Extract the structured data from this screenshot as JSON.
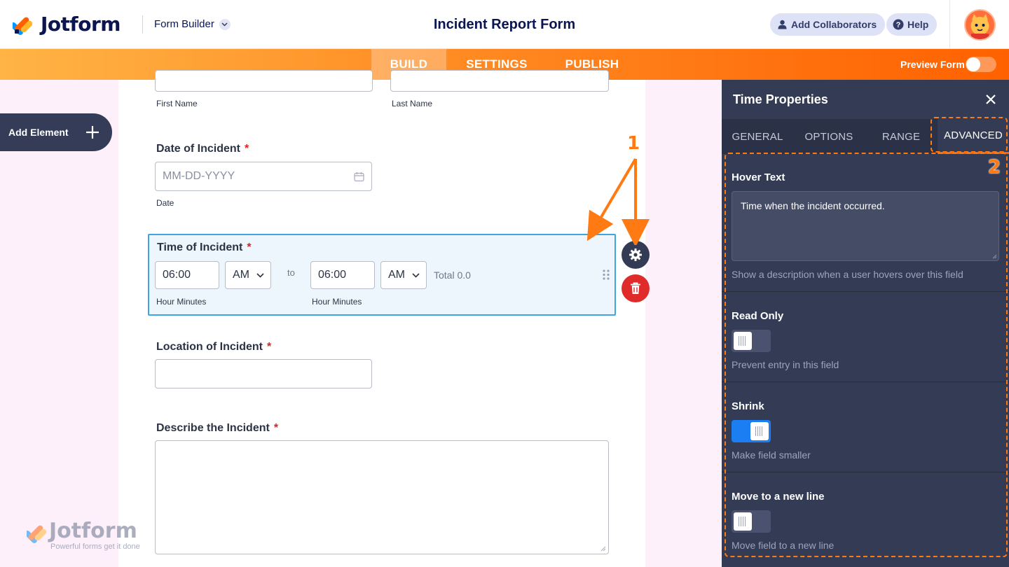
{
  "header": {
    "logo_text": "Jotform",
    "form_builder_label": "Form Builder",
    "form_title": "Incident Report Form",
    "add_collaborators_label": "Add Collaborators",
    "help_label": "Help"
  },
  "nav": {
    "tabs": [
      {
        "label": "BUILD",
        "active": true
      },
      {
        "label": "SETTINGS",
        "active": false
      },
      {
        "label": "PUBLISH",
        "active": false
      }
    ],
    "preview_label": "Preview Form"
  },
  "sidebar": {
    "add_element_label": "Add Element"
  },
  "form": {
    "name_sublabels": {
      "first": "First Name",
      "last": "Last Name"
    },
    "date_field": {
      "label": "Date of Incident",
      "required_mark": "*",
      "placeholder": "MM-DD-YYYY",
      "sublabel": "Date"
    },
    "time_field": {
      "label": "Time of Incident",
      "required_mark": "*",
      "start_time": "06:00",
      "start_ampm": "AM",
      "to_label": "to",
      "end_time": "06:00",
      "end_ampm": "AM",
      "total_label": "Total 0.0",
      "start_sublabel": "Hour Minutes",
      "end_sublabel": "Hour Minutes"
    },
    "location_field": {
      "label": "Location of Incident",
      "required_mark": "*"
    },
    "describe_field": {
      "label": "Describe the Incident",
      "required_mark": "*"
    }
  },
  "panel": {
    "title": "Time Properties",
    "tabs": [
      {
        "label": "GENERAL",
        "active": false
      },
      {
        "label": "OPTIONS",
        "active": false
      },
      {
        "label": "RANGE",
        "active": false
      },
      {
        "label": "ADVANCED",
        "active": true
      }
    ],
    "hover_text": {
      "title": "Hover Text",
      "value": "Time when the incident occurred.",
      "description": "Show a description when a user hovers over this field"
    },
    "read_only": {
      "title": "Read Only",
      "on": false,
      "description": "Prevent entry in this field"
    },
    "shrink": {
      "title": "Shrink",
      "on": true,
      "description": "Make field smaller"
    },
    "new_line": {
      "title": "Move to a new line",
      "on": false,
      "description": "Move field to a new line"
    }
  },
  "annotations": {
    "marker_1": "1",
    "marker_2": "2",
    "accent_color": "#ff7a12"
  },
  "watermark": {
    "logo_text": "Jotform",
    "tagline": "Powerful forms get it done"
  },
  "colors": {
    "brand_orange": "#ff6100",
    "panel_bg": "#343c55",
    "selection_blue": "#3fa4e0",
    "toggle_on": "#1b7ef3",
    "delete_red": "#e02b2b"
  }
}
